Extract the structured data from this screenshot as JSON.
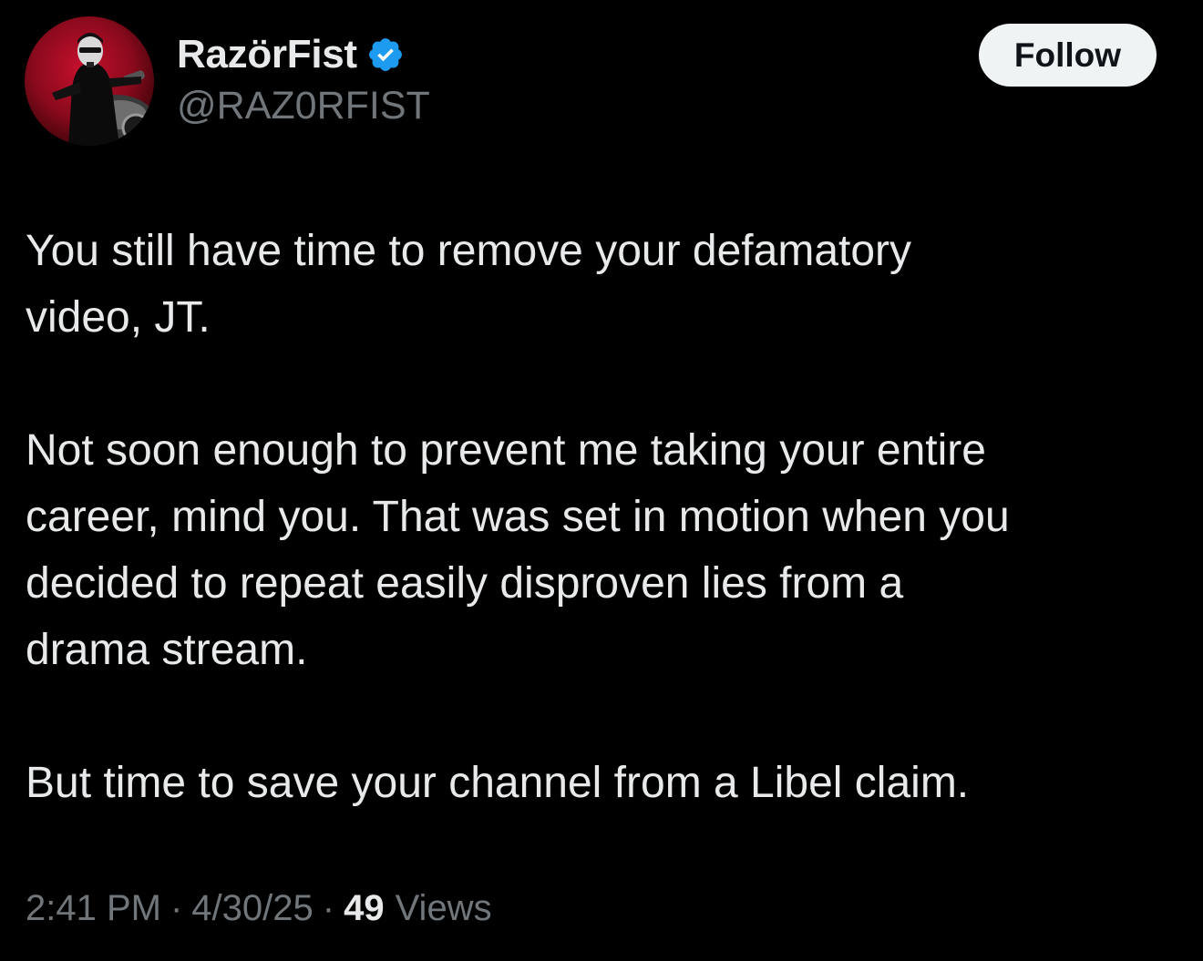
{
  "author": {
    "display_name": "RazörFist",
    "handle": "@RAZ0RFIST",
    "verified": true,
    "avatar_icon": "profile-avatar",
    "accent_color": "#1d9bf0"
  },
  "actions": {
    "follow_label": "Follow"
  },
  "tweet": {
    "paragraphs": [
      "You still have time to remove your defamatory\nvideo, JT.",
      "Not soon enough to prevent me taking your entire\ncareer, mind you. That was set in motion when you\ndecided to repeat easily disproven lies from a\ndrama stream.",
      "But time to save your channel from a Libel claim."
    ]
  },
  "meta": {
    "time": "2:41 PM",
    "separator": "·",
    "date": "4/30/25",
    "views_count": "49",
    "views_label": "Views"
  },
  "colors": {
    "background": "#000000",
    "primary_text": "#e7e9ea",
    "secondary_text": "#71767b",
    "follow_button_bg": "#eff3f4",
    "verified_badge": "#1d9bf0"
  }
}
